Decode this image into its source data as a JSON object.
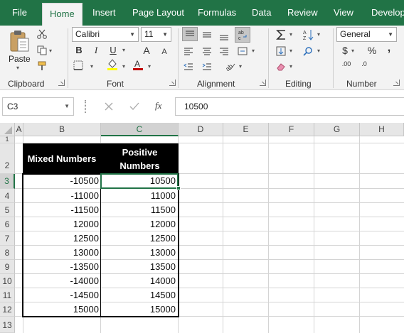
{
  "ribbon": {
    "tabs": [
      {
        "label": "File",
        "active": false
      },
      {
        "label": "Home",
        "active": true
      },
      {
        "label": "Insert",
        "active": false
      },
      {
        "label": "Page Layout",
        "active": false
      },
      {
        "label": "Formulas",
        "active": false
      },
      {
        "label": "Data",
        "active": false
      },
      {
        "label": "Review",
        "active": false
      },
      {
        "label": "View",
        "active": false
      },
      {
        "label": "Develope",
        "active": false
      }
    ],
    "clipboard": {
      "paste_label": "Paste",
      "group_label": "Clipboard"
    },
    "font": {
      "font_name": "Calibri",
      "font_size": "11",
      "bold": "B",
      "italic": "I",
      "underline": "U",
      "grow": "A",
      "shrink": "A",
      "group_label": "Font",
      "fill_color": "#ffff00",
      "font_color": "#c00000"
    },
    "alignment": {
      "group_label": "Alignment"
    },
    "editing": {
      "group_label": "Editing"
    },
    "number": {
      "format": "General",
      "currency": "$",
      "percent": "%",
      "comma": ",",
      "inc_decimal": ".00",
      "dec_decimal": ".0",
      "group_label": "Number"
    }
  },
  "formula_bar": {
    "name_box": "C3",
    "fx": "fx",
    "value": "10500"
  },
  "sheet": {
    "columns": [
      "A",
      "B",
      "C",
      "D",
      "E",
      "F",
      "G",
      "H"
    ],
    "selected_column": "C",
    "rows": [
      "1",
      "2",
      "3",
      "4",
      "5",
      "6",
      "7",
      "8",
      "9",
      "10",
      "11",
      "12",
      "13"
    ],
    "selected_row": "3",
    "table": {
      "header_b": "Mixed Numbers",
      "header_c_line1": "Positive",
      "header_c_line2": "Numbers",
      "mixed": [
        "-10500",
        "-11000",
        "-11500",
        "12000",
        "12500",
        "13000",
        "-13500",
        "-14000",
        "-14500",
        "15000"
      ],
      "positive": [
        "10500",
        "11000",
        "11500",
        "12000",
        "12500",
        "13000",
        "13500",
        "14000",
        "14500",
        "15000"
      ]
    },
    "accent_color": "#217346"
  }
}
